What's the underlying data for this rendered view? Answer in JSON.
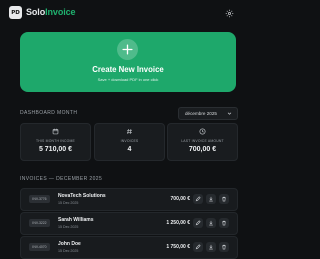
{
  "app": {
    "logo_text": "PD",
    "title_main": "Solo",
    "title_accent": "Invoice"
  },
  "hero": {
    "title": "Create New Invoice",
    "subtitle": "Save + download PDF in one click"
  },
  "dashboard": {
    "section_label": "DASHBOARD MONTH",
    "month_select": "décembre 2025",
    "cards": [
      {
        "icon": "calendar-icon",
        "label": "THIS MONTH INCOME",
        "value": "5 710,00 €"
      },
      {
        "icon": "hash-icon",
        "label": "INVOICES",
        "value": "4"
      },
      {
        "icon": "clock-icon",
        "label": "LAST INVOICE AMOUNT",
        "value": "700,00 €"
      }
    ]
  },
  "invoices": {
    "section_label": "INVOICES — DECEMBER 2025",
    "rows": [
      {
        "number": "INV-3776",
        "client": "NovaTech Solutions",
        "date": "15 Dec 2025",
        "amount": "700,00 €"
      },
      {
        "number": "INV-3222",
        "client": "Sarah Williams",
        "date": "15 Dec 2025",
        "amount": "1 250,00 €"
      },
      {
        "number": "INV-4070",
        "client": "John Doe",
        "date": "15 Dec 2025",
        "amount": "1 750,00 €"
      }
    ]
  },
  "colors": {
    "accent": "#1ea86b",
    "background": "#0f1113",
    "card": "#191c1f"
  }
}
